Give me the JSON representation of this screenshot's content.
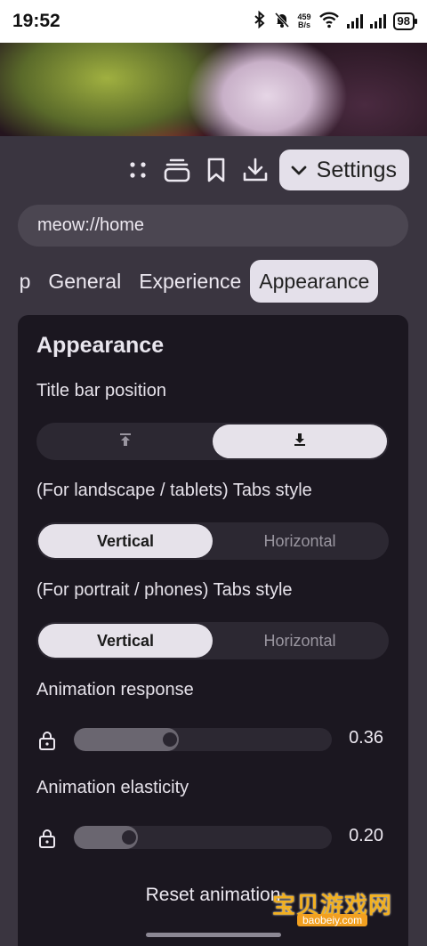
{
  "status": {
    "time": "19:52",
    "net_speed_value": "459",
    "net_speed_unit": "B/s",
    "battery": "98"
  },
  "toolbar": {
    "settings_label": "Settings"
  },
  "url_bar": {
    "value": "meow://home"
  },
  "tabs": [
    {
      "label": "Start Up",
      "active": false
    },
    {
      "label": "General",
      "active": false
    },
    {
      "label": "Experience",
      "active": false
    },
    {
      "label": "Appearance",
      "active": true
    }
  ],
  "appearance": {
    "title": "Appearance",
    "title_bar_position": {
      "label": "Title bar position",
      "options": [
        "top-arrow-icon",
        "bottom-arrow-icon"
      ],
      "selected": 1
    },
    "landscape_tabs": {
      "label": "(For landscape / tablets) Tabs style",
      "options": [
        "Vertical",
        "Horizontal"
      ],
      "selected": 0
    },
    "portrait_tabs": {
      "label": "(For portrait / phones) Tabs style",
      "options": [
        "Vertical",
        "Horizontal"
      ],
      "selected": 0
    },
    "animation_response": {
      "label": "Animation response",
      "value": "0.36",
      "fraction": 0.36
    },
    "animation_elasticity": {
      "label": "Animation elasticity",
      "value": "0.20",
      "fraction": 0.2
    },
    "reset_label": "Reset animation"
  },
  "watermark": {
    "text": "宝贝游戏网",
    "url": "baobeiy.com"
  },
  "colors": {
    "background": "#3a3540",
    "card": "#1b1720",
    "accent_light": "#e4e0ea"
  }
}
